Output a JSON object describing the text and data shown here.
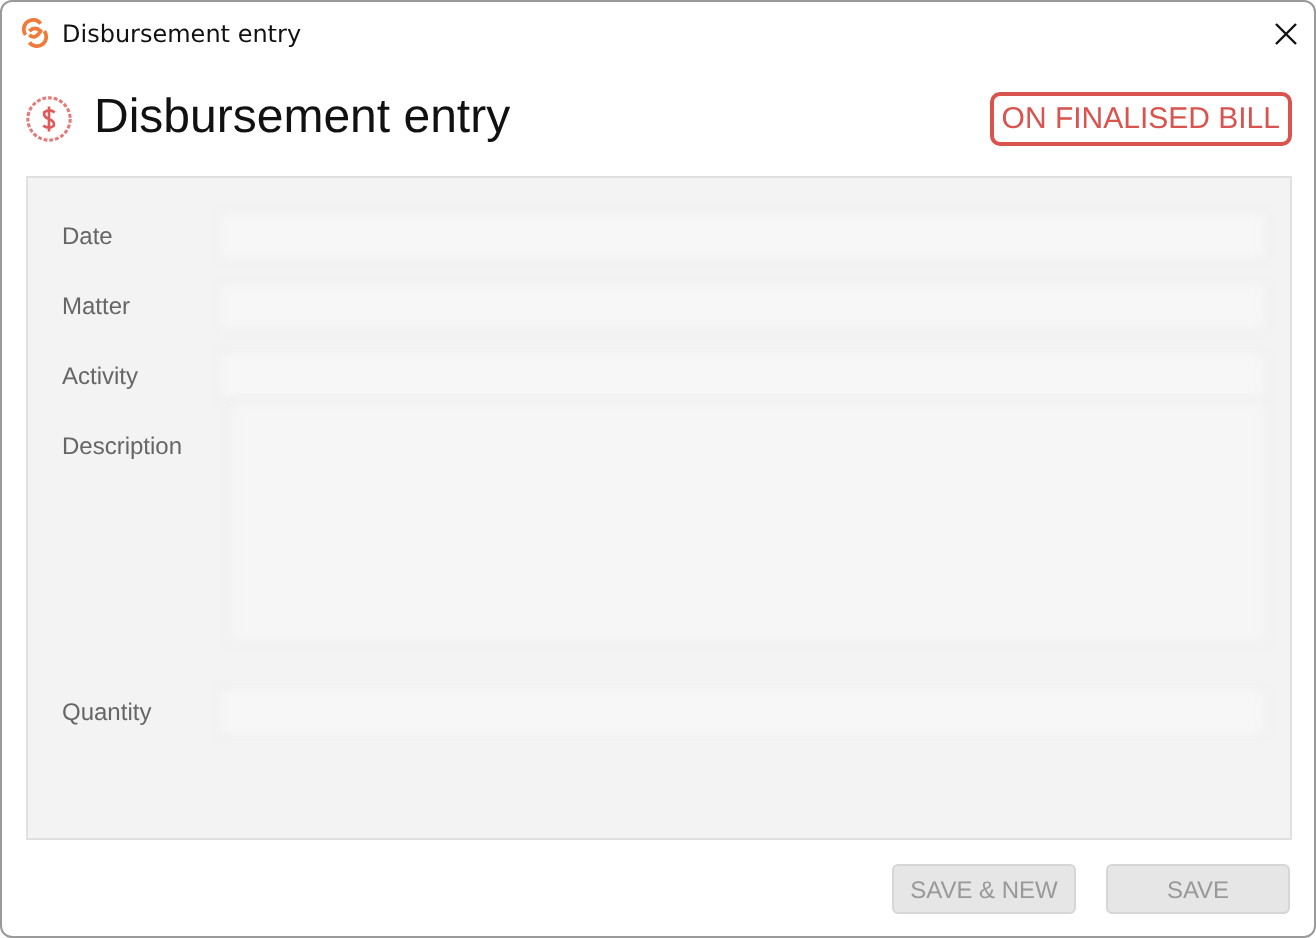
{
  "window": {
    "title": "Disbursement entry"
  },
  "header": {
    "title": "Disbursement entry",
    "badge": "ON FINALISED BILL"
  },
  "form": {
    "fields": [
      {
        "label": "Date",
        "kind": "row"
      },
      {
        "label": "Matter",
        "kind": "row"
      },
      {
        "label": "Activity",
        "kind": "row"
      },
      {
        "label": "Description",
        "kind": "area"
      },
      {
        "label": "Quantity",
        "kind": "row"
      }
    ]
  },
  "buttons": [
    {
      "label": "SAVE & NEW",
      "disabled": true
    },
    {
      "label": "SAVE",
      "disabled": true
    }
  ]
}
